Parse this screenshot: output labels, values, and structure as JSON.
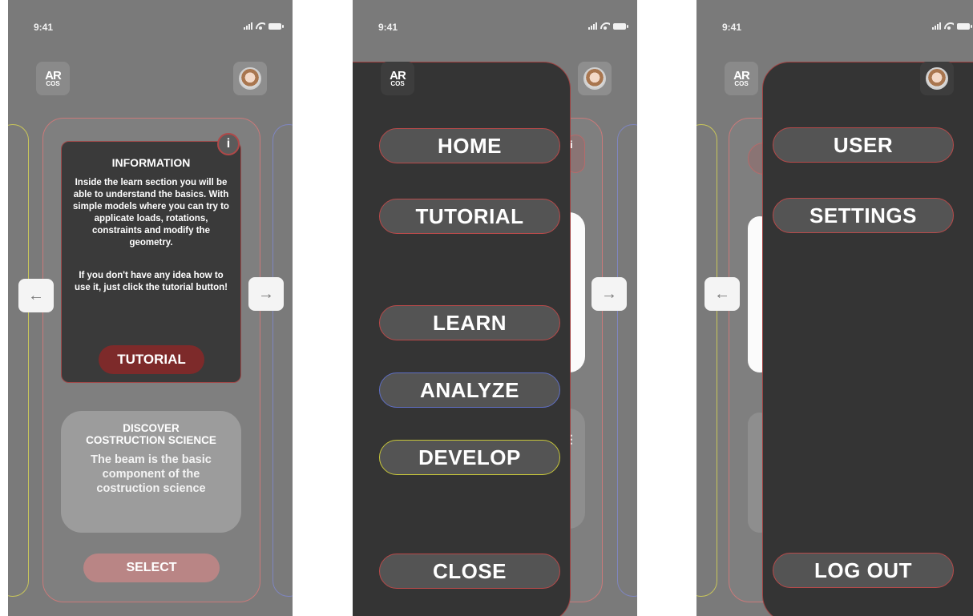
{
  "status": {
    "time": "9:41"
  },
  "logo": {
    "line1": "AR",
    "line2": "COS"
  },
  "screen1": {
    "info": {
      "badge": "i",
      "title": "INFORMATION",
      "body": "Inside the learn section you will be able to understand the basics. With simple models where you can try to applicate loads, rotations, constraints and modify the geometry.",
      "body2": "If you don't have any idea how to use it, just click the tutorial button!",
      "button_label": "TUTORIAL"
    },
    "card": {
      "title_line1": "DISCOVER",
      "title_line2": "COSTRUCTION SCIENCE",
      "body": "The beam is the basic component of the costruction science"
    },
    "select_label": "SELECT",
    "arrow_left": "←",
    "arrow_right": "→"
  },
  "screen2": {
    "menu": [
      "HOME",
      "TUTORIAL",
      "LEARN",
      "ANALYZE",
      "DEVELOP",
      "CLOSE"
    ],
    "badge": "i",
    "arrow_right": "→",
    "dots": "⋮"
  },
  "screen3": {
    "menu": [
      "USER",
      "SETTINGS",
      "LOG OUT"
    ],
    "arrow_left": "←"
  },
  "colors": {
    "menu_bg": "#343434",
    "button_bg": "#545454",
    "accent_red": "#b84a4a",
    "accent_blue": "#5f6fc4",
    "accent_yellow": "#c7c63a",
    "tutorial_bg": "#7d2a2a",
    "select_bg": "#b98585"
  }
}
